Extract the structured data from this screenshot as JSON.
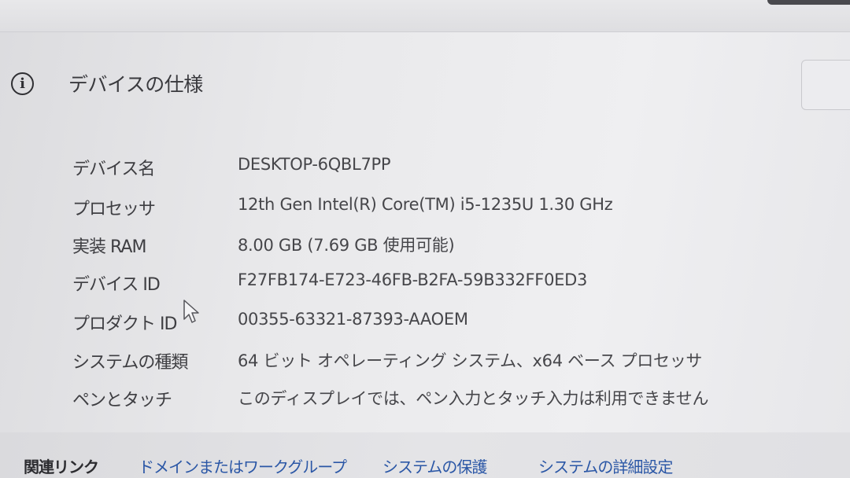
{
  "section": {
    "title": "デバイスの仕様",
    "icon": "info-icon"
  },
  "specs": [
    {
      "label": "デバイス名",
      "value": "DESKTOP-6QBL7PP"
    },
    {
      "label": "プロセッサ",
      "value": "12th Gen Intel(R) Core(TM) i5-1235U   1.30 GHz"
    },
    {
      "label": "実装 RAM",
      "value": "8.00 GB (7.69 GB 使用可能)"
    },
    {
      "label": "デバイス ID",
      "value": "F27FB174-E723-46FB-B2FA-59B332FF0ED3"
    },
    {
      "label": "プロダクト ID",
      "value": "00355-63321-87393-AAOEM"
    },
    {
      "label": "システムの種類",
      "value": "64 ビット オペレーティング システム、x64 ベース プロセッサ"
    },
    {
      "label": "ペンとタッチ",
      "value": "このディスプレイでは、ペン入力とタッチ入力は利用できません"
    }
  ],
  "related": {
    "label": "関連リンク",
    "links": [
      "ドメインまたはワークグループ",
      "システムの保護",
      "システムの詳細設定"
    ]
  },
  "colors": {
    "link": "#2b57a6"
  }
}
